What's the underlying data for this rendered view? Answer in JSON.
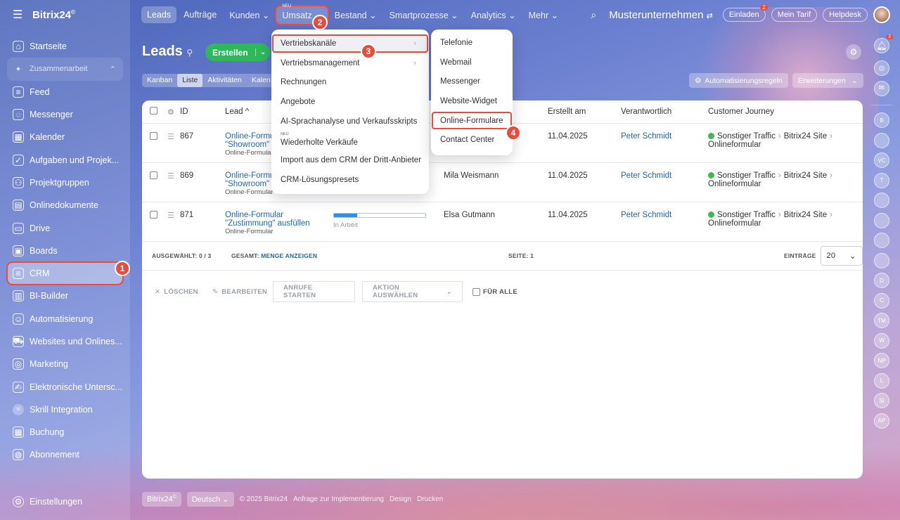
{
  "app": {
    "logo": "Bitrix24",
    "logo_mark": "©"
  },
  "sidebar": {
    "items": [
      {
        "label": "Startseite",
        "icon": "home-icon"
      },
      {
        "label": "Zusammenarbeit",
        "icon": "collab-icon",
        "group": true
      },
      {
        "label": "Feed",
        "icon": "feed-icon"
      },
      {
        "label": "Messenger",
        "icon": "chat-icon"
      },
      {
        "label": "Kalender",
        "icon": "calendar-icon"
      },
      {
        "label": "Aufgaben und Projek...",
        "icon": "tasks-icon"
      },
      {
        "label": "Projektgruppen",
        "icon": "groups-icon"
      },
      {
        "label": "Onlinedokumente",
        "icon": "docs-icon"
      },
      {
        "label": "Drive",
        "icon": "drive-icon"
      },
      {
        "label": "Boards",
        "icon": "boards-icon"
      },
      {
        "label": "CRM",
        "icon": "crm-icon",
        "active": true
      },
      {
        "label": "BI-Builder",
        "icon": "chart-icon"
      },
      {
        "label": "Automatisierung",
        "icon": "robot-icon"
      },
      {
        "label": "Websites und Onlines...",
        "icon": "cart-icon"
      },
      {
        "label": "Marketing",
        "icon": "target-icon"
      },
      {
        "label": "Elektronische Untersc...",
        "icon": "sign-icon"
      },
      {
        "label": "Skrill Integration",
        "icon": "si-icon",
        "badge": "SI"
      },
      {
        "label": "Buchung",
        "icon": "booking-icon"
      },
      {
        "label": "Abonnement",
        "icon": "subscription-icon"
      }
    ],
    "settings": "Einstellungen",
    "crm_step": "1"
  },
  "topbar": {
    "tabs": [
      "Leads",
      "Aufträge",
      "Kunden",
      "Umsatz",
      "Bestand",
      "Smartprozesse",
      "Analytics",
      "Mehr"
    ],
    "neu_label": "NEU",
    "umsatz_step": "2",
    "company": "Musterunternehmen",
    "invite": "Einladen",
    "invite_count": "2",
    "tariff": "Mein Tarif",
    "helpdesk": "Helpdesk"
  },
  "page": {
    "title": "Leads",
    "create_button": "Erstellen",
    "view_tabs": [
      "Kanban",
      "Liste",
      "Aktivitäten",
      "Kalen"
    ],
    "automation_button": "Automatisierungsregeln",
    "extensions_button": "Erweiterungen"
  },
  "table": {
    "headers": {
      "id": "ID",
      "lead": "Lead",
      "created": "Erstellt am",
      "responsible": "Verantwortlich",
      "journey": "Customer Journey"
    },
    "rows": [
      {
        "id": "867",
        "lead_title": "Online-Formul",
        "lead_title2": "\"Showroom\"",
        "lead_sub": "Online-Formular",
        "stage": "",
        "name": "",
        "created": "11.04.2025",
        "responsible": "Peter Schmidt",
        "journey_a": "Sonstiger Traffic",
        "journey_b": "Bitrix24 Site",
        "journey_c": "Onlineformular"
      },
      {
        "id": "869",
        "lead_title": "Online-Formu",
        "lead_title2": "\"Showroom\"",
        "lead_sub": "Online-Formular",
        "stage": "",
        "name": "Mila Weismann",
        "created": "11.04.2025",
        "responsible": "Peter Schmidt",
        "journey_a": "Sonstiger Traffic",
        "journey_b": "Bitrix24 Site",
        "journey_c": "Onlineformular"
      },
      {
        "id": "871",
        "lead_title": "Online-Formular",
        "lead_title2": "\"Zustimmung\" ausfüllen",
        "lead_sub": "Online-Formular",
        "stage": "In Arbeit",
        "stage_progress": 0.25,
        "name": "Elsa Gutmann",
        "created": "11.04.2025",
        "responsible": "Peter Schmidt",
        "journey_a": "Sonstiger Traffic",
        "journey_b": "Bitrix24 Site",
        "journey_c": "Onlineformular"
      }
    ],
    "footer": {
      "selected_label": "AUSGEWÄHLT:",
      "selected_value": "0 / 3",
      "total_label": "GESAMT:",
      "total_link": "MENGE ANZEIGEN",
      "page_label": "SEITE:",
      "page_value": "1",
      "entries_label": "EINTRÄGE",
      "entries_value": "20"
    },
    "actions": {
      "delete": "LÖSCHEN",
      "edit": "BEARBEITEN",
      "calls": "ANRUFE STARTEN",
      "choose": "AKTION AUSWÄHLEN",
      "for_all": "FÜR ALLE"
    }
  },
  "menu_umsatz": {
    "items": [
      {
        "label": "Vertriebskanäle",
        "submenu": true
      },
      {
        "label": "Vertriebsmanagement",
        "submenu": true
      },
      {
        "label": "Rechnungen"
      },
      {
        "label": "Angebote"
      },
      {
        "label": "AI-Sprachanalyse und Verkaufsskripts"
      },
      {
        "label": "Wiederholte Verkäufe",
        "neu": "NEU"
      },
      {
        "label": "Import aus dem CRM der Dritt-Anbieter"
      },
      {
        "label": "CRM-Lösungspresets"
      }
    ],
    "step": "3"
  },
  "menu_channels": {
    "items": [
      "Telefonie",
      "Webmail",
      "Messenger",
      "Website-Widget",
      "Online-Formulare",
      "Contact Center"
    ],
    "step": "4"
  },
  "rail": {
    "notif_count": "3",
    "avatars": [
      "B",
      "",
      "VC",
      "T",
      "",
      "",
      "",
      "",
      "D",
      "C",
      "TM",
      "W",
      "NP",
      "L",
      "SI",
      "AP"
    ]
  },
  "bottom": {
    "logo": "Bitrix24",
    "language": "Deutsch",
    "copyright": "© 2025 Bitrix24",
    "links": [
      "Anfrage zur Implementierung",
      "Design",
      "Drucken"
    ]
  },
  "colors": {
    "accent_red": "#e84d3c",
    "create_green": "#2eb85c",
    "link_blue": "#2067b0"
  }
}
